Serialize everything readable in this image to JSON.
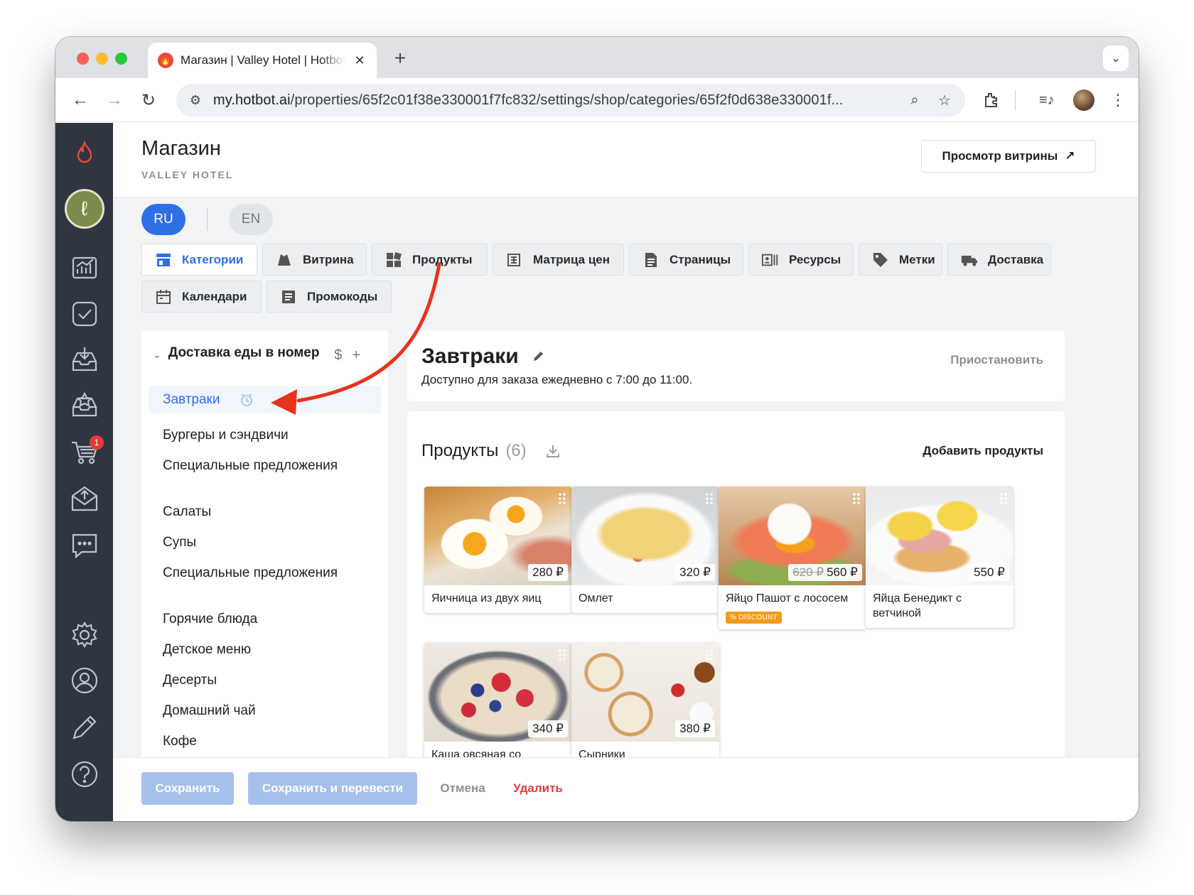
{
  "browser": {
    "tab_title": "Магазин | Valley Hotel | Hotbot",
    "url_host": "my.hotbot.ai",
    "url_path": "/properties/65f2c01f38e330001f7fc832/settings/shop/categories/65f2f0d638e330001f..."
  },
  "rail": {
    "cart_badge": "1"
  },
  "header": {
    "title": "Магазин",
    "subtitle": "VALLEY HOTEL",
    "preview_button": "Просмотр витрины"
  },
  "languages": [
    "RU",
    "EN"
  ],
  "nav_tabs": [
    {
      "label": "Категории",
      "icon": "storefront-icon",
      "active": true
    },
    {
      "label": "Витрина",
      "icon": "showcase-icon"
    },
    {
      "label": "Продукты",
      "icon": "products-grid-icon"
    },
    {
      "label": "Матрица цен",
      "icon": "price-matrix-icon"
    },
    {
      "label": "Страницы",
      "icon": "pages-icon"
    },
    {
      "label": "Ресурсы",
      "icon": "resources-icon"
    },
    {
      "label": "Метки",
      "icon": "tag-icon"
    },
    {
      "label": "Доставка",
      "icon": "truck-icon"
    },
    {
      "label": "Календари",
      "icon": "calendar-icon"
    },
    {
      "label": "Промокоды",
      "icon": "promo-icon"
    }
  ],
  "categories": {
    "group_title": "Доставка еды в номер",
    "items": [
      "Завтраки",
      "Бургеры и сэндвичи",
      "Специальные предложения",
      "Салаты",
      "Супы",
      "Специальные предложения",
      "Горячие блюда",
      "Детское меню",
      "Десерты",
      "Домашний чай",
      "Кофе"
    ],
    "active_index": 0
  },
  "category_detail": {
    "title": "Завтраки",
    "description": "Доступно для заказа ежедневно с 7:00 до 11:00.",
    "pause_label": "Приостановить"
  },
  "products": {
    "heading": "Продукты",
    "count": "(6)",
    "add_label": "Добавить продукты",
    "items": [
      {
        "name": "Яичница из двух яиц",
        "price": "280 ₽"
      },
      {
        "name": "Омлет",
        "price": "320 ₽"
      },
      {
        "name": "Яйцо Пашот с лососем",
        "price": "560 ₽",
        "old_price": "620 ₽",
        "badge": "% DISCOUNT"
      },
      {
        "name": "Яйца Бенедикт с ветчиной",
        "price": "550 ₽"
      },
      {
        "name": "Каша овсяная со свежими ягодами",
        "price": "340 ₽"
      },
      {
        "name": "Сырники",
        "price": "380 ₽"
      }
    ]
  },
  "footer": {
    "save": "Сохранить",
    "save_translate": "Сохранить и перевести",
    "cancel": "Отмена",
    "delete": "Удалить"
  },
  "colors": {
    "accent": "#2f6fe4",
    "rail": "#2f3541",
    "annotation_arrow": "#e8321e",
    "danger": "#e23b3b"
  }
}
